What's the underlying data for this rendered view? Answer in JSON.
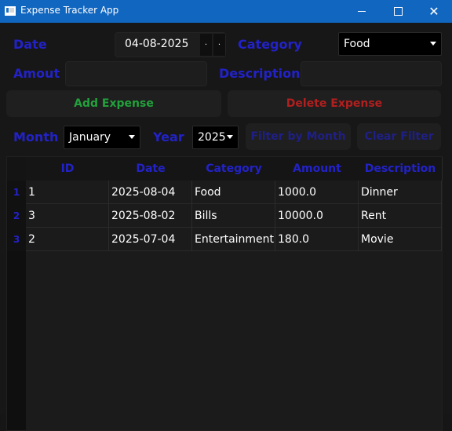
{
  "window": {
    "title": "Expense Tracker App",
    "min_icon": "minimize-icon",
    "max_icon": "maximize-icon",
    "close_icon": "close-icon",
    "close_glyph": "✕"
  },
  "form": {
    "date_label": "Date",
    "date_value": "04-08-2025",
    "spin_up_icon": "up-icon",
    "spin_down_icon": "down-icon",
    "spin_up": "·",
    "spin_down": "·",
    "category_label": "Category",
    "category_value": "Food",
    "amount_label": "Amout",
    "amount_value": "",
    "description_label": "Description",
    "description_value": ""
  },
  "buttons": {
    "add": "Add Expense",
    "delete": "Delete Expense",
    "filter": "Filter by Month",
    "clear": "Clear Filter"
  },
  "filter": {
    "month_label": "Month",
    "month_value": "January",
    "year_label": "Year",
    "year_value": "2025"
  },
  "table": {
    "headers": [
      "ID",
      "Date",
      "Category",
      "Amount",
      "Description"
    ],
    "row_numbers": [
      "1",
      "2",
      "3"
    ],
    "rows": [
      [
        "1",
        "2025-08-04",
        "Food",
        "1000.0",
        "Dinner"
      ],
      [
        "3",
        "2025-08-02",
        "Bills",
        "10000.0",
        "Rent"
      ],
      [
        "2",
        "2025-07-04",
        "Entertainment",
        "180.0",
        "Movie"
      ]
    ]
  },
  "colors": {
    "titlebar": "#1166c0",
    "label": "#2222c8",
    "add": "#22a13b",
    "delete": "#b21f1f",
    "background": "#171717"
  }
}
